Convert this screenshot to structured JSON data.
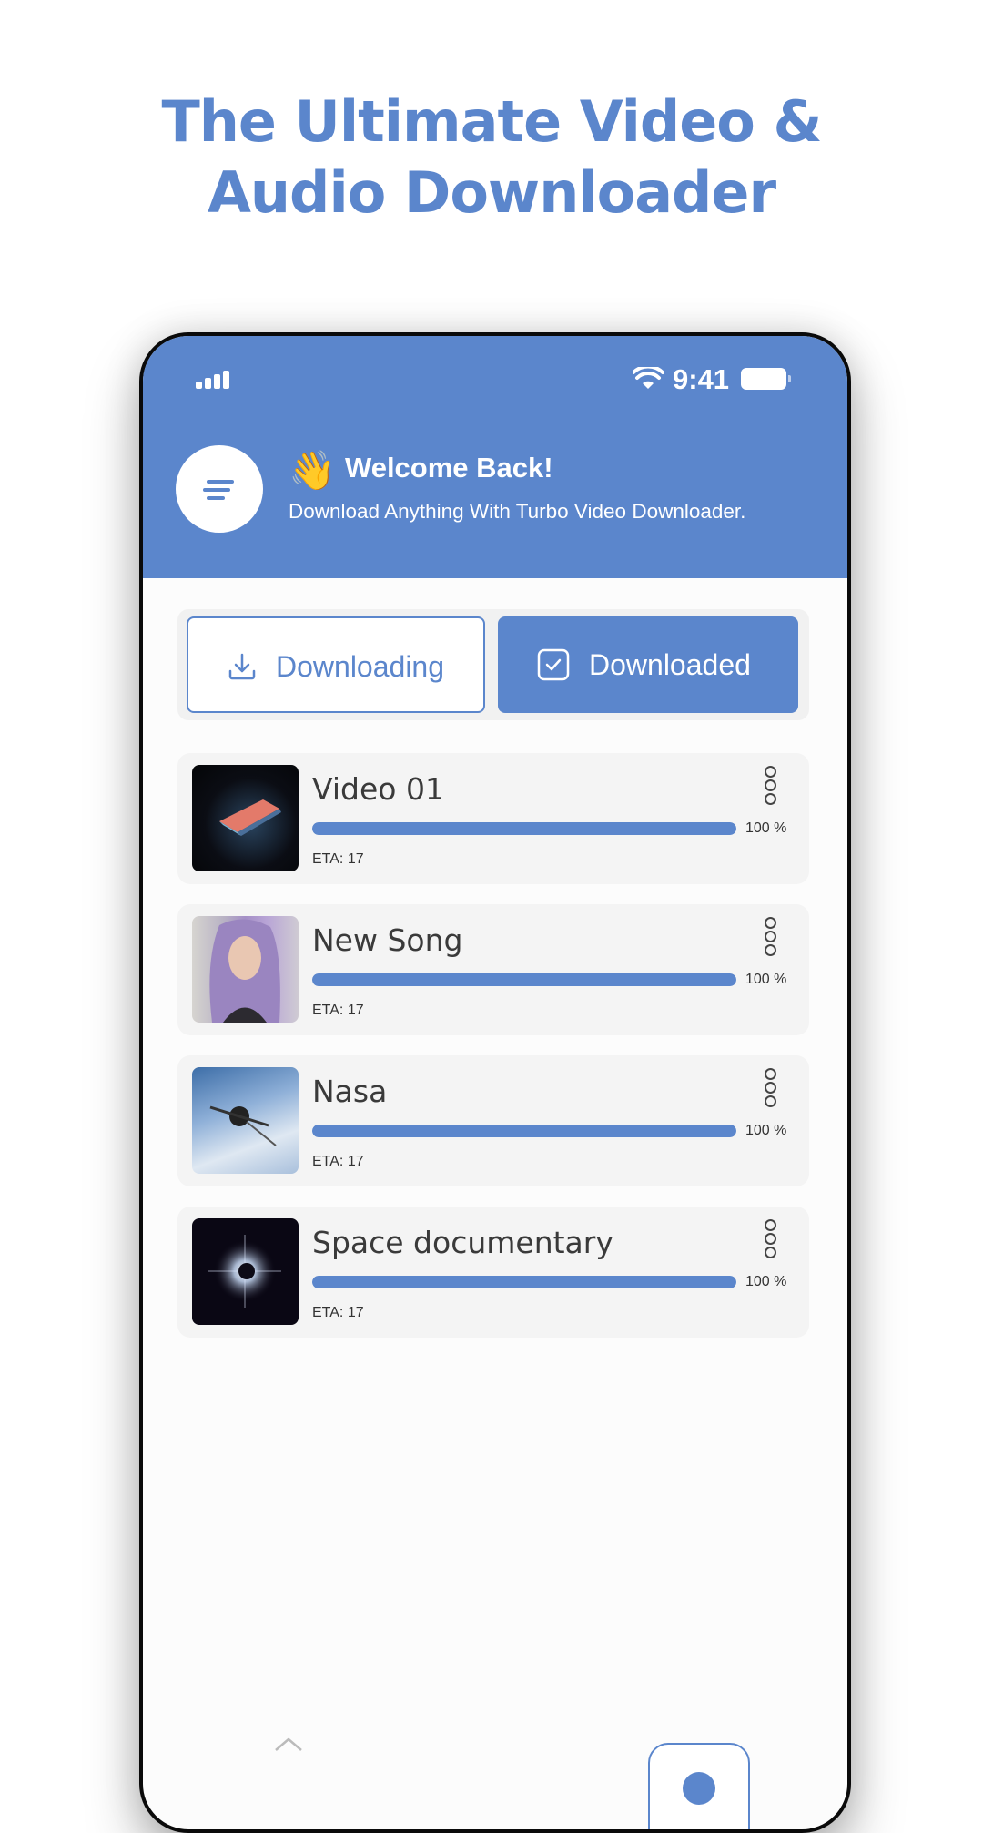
{
  "promo": {
    "title_line1": "The Ultimate Video &",
    "title_line2": "Audio Downloader"
  },
  "status_bar": {
    "time": "9:41"
  },
  "header": {
    "wave_emoji": "👋",
    "welcome": "Welcome Back!",
    "subtitle": "Download Anything With Turbo Video Downloader."
  },
  "tabs": [
    {
      "label": "Downloading",
      "icon": "download-icon",
      "active": false
    },
    {
      "label": "Downloaded",
      "icon": "check-square-icon",
      "active": true
    }
  ],
  "downloads": [
    {
      "title": "Video 01",
      "progress": 100,
      "percent_label": "100 %",
      "eta": "ETA: 17",
      "thumbnail": "laptop-image"
    },
    {
      "title": "New Song",
      "progress": 100,
      "percent_label": "100 %",
      "eta": "ETA: 17",
      "thumbnail": "woman-portrait-image"
    },
    {
      "title": "Nasa",
      "progress": 100,
      "percent_label": "100 %",
      "eta": "ETA: 17",
      "thumbnail": "satellite-image"
    },
    {
      "title": "Space documentary",
      "progress": 100,
      "percent_label": "100 %",
      "eta": "ETA: 17",
      "thumbnail": "eclipse-image"
    }
  ],
  "colors": {
    "accent": "#5b86cc",
    "card_bg": "#f4f4f4",
    "text_dark": "#3a3a3a"
  }
}
